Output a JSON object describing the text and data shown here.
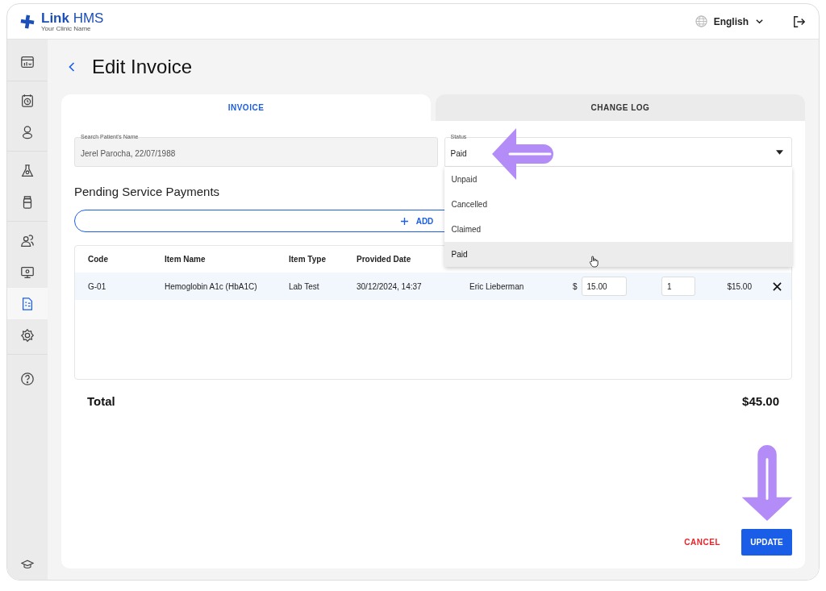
{
  "header": {
    "brand": {
      "name_bold": "Link",
      "name_rest": "HMS",
      "subtitle": "Your Clinic Name"
    },
    "language": "English"
  },
  "sidebar": {
    "groups": [
      {
        "items": [
          {
            "kind": "dashboard",
            "selected": false
          }
        ]
      },
      {
        "items": [
          {
            "kind": "calendar",
            "selected": false
          },
          {
            "kind": "person",
            "selected": false
          }
        ]
      },
      {
        "items": [
          {
            "kind": "flask",
            "selected": false
          },
          {
            "kind": "bottle",
            "selected": false
          }
        ]
      },
      {
        "items": [
          {
            "kind": "people",
            "selected": false
          },
          {
            "kind": "monitor",
            "selected": false
          },
          {
            "kind": "invoice",
            "selected": true
          },
          {
            "kind": "settings",
            "selected": false
          }
        ]
      },
      {
        "items": [
          {
            "kind": "help",
            "selected": false
          }
        ]
      }
    ],
    "bottom": {
      "kind": "cap",
      "selected": false
    }
  },
  "page": {
    "title": "Edit Invoice"
  },
  "tabs": [
    {
      "label": "INVOICE",
      "selected": true
    },
    {
      "label": "CHANGE LOG",
      "selected": false
    }
  ],
  "patient_field": {
    "label": "Search Patient’s Name",
    "value": "Jerel Parocha, 22/07/1988"
  },
  "status_field": {
    "label": "Status",
    "value": "Paid",
    "expanded": true,
    "options": [
      {
        "label": "Unpaid",
        "selected": false
      },
      {
        "label": "Cancelled",
        "selected": false
      },
      {
        "label": "Claimed",
        "selected": false
      },
      {
        "label": "Paid",
        "selected": true
      }
    ]
  },
  "section_title": "Pending Service Payments",
  "add_button": {
    "label": "ADD"
  },
  "table": {
    "columns": [
      "Code",
      "Item Name",
      "Item Type",
      "Provided Date"
    ],
    "rows": [
      {
        "code": "G-01",
        "item_name": "Hemoglobin A1c (HbA1C)",
        "item_type": "Lab Test",
        "provided_date": "30/12/2024, 14:37",
        "column_5": "Eric Lieberman",
        "currency": "$",
        "price": "15.00",
        "quantity": "1",
        "amount": "$15.00"
      }
    ]
  },
  "total": {
    "label": "Total",
    "value": "$45.00"
  },
  "buttons": {
    "cancel": "CANCEL",
    "update": "UPDATE"
  }
}
